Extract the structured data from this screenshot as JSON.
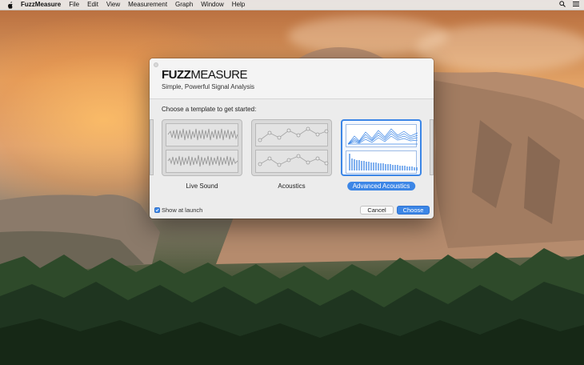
{
  "menubar": {
    "app_name": "FuzzMeasure",
    "items": [
      "File",
      "Edit",
      "View",
      "Measurement",
      "Graph",
      "Window",
      "Help"
    ]
  },
  "dialog": {
    "logo_fuzz": "FUZZ",
    "logo_measure": "MEASURE",
    "tagline": "Simple, Powerful Signal Analysis",
    "prompt": "Choose a template to get started:",
    "templates": [
      {
        "label": "Live Sound",
        "selected": false
      },
      {
        "label": "Acoustics",
        "selected": false
      },
      {
        "label": "Advanced Acoustics",
        "selected": true
      }
    ],
    "show_at_launch_label": "Show at launch",
    "show_at_launch_checked": true,
    "cancel_label": "Cancel",
    "choose_label": "Choose"
  },
  "colors": {
    "accent": "#3c86e6",
    "dialog_bg": "#ececec"
  },
  "icons": {
    "menubar_left": "apple-logo-icon",
    "menubar_right": [
      "search-icon",
      "list-icon"
    ]
  }
}
